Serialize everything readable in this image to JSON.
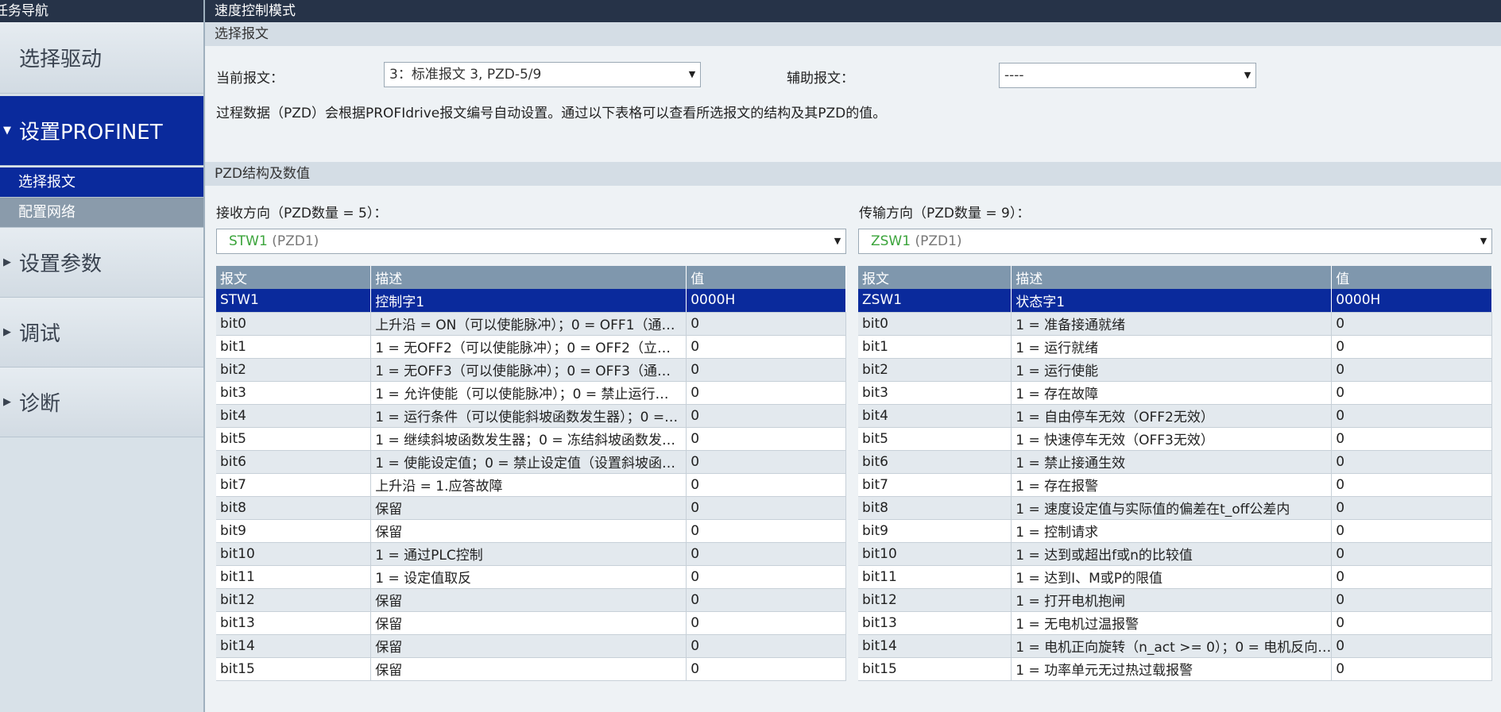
{
  "sidebar": {
    "header": "任务导航",
    "items": [
      {
        "label": "选择驱动"
      },
      {
        "label": "设置PROFINET"
      },
      {
        "label": "选择报文"
      },
      {
        "label": "配置网络"
      },
      {
        "label": "设置参数"
      },
      {
        "label": "调试"
      },
      {
        "label": "诊断"
      }
    ]
  },
  "main": {
    "header": "速度控制模式",
    "select_section": "选择报文",
    "current_label": "当前报文：",
    "current_value": "3：标准报文 3, PZD-5/9",
    "aux_label": "辅助报文：",
    "aux_value": "----",
    "info": "过程数据（PZD）会根据PROFIdrive报文编号自动设置。通过以下表格可以查看所选报文的结构及其PZD的值。",
    "pzd_section": "PZD结构及数值",
    "recv_label": "接收方向（PZD数量 = 5）：",
    "send_label": "传输方向（PZD数量 = 9）：",
    "recv_select_name": "STW1",
    "recv_select_pzd": "(PZD1)",
    "send_select_name": "ZSW1",
    "send_select_pzd": "(PZD1)"
  },
  "table_headers": [
    "报文",
    "描述",
    "值"
  ],
  "recv_rows": [
    [
      "STW1",
      "控制字1",
      "0000H"
    ],
    [
      "bit0",
      "上升沿 = ON（可以使能脉冲）；0 = OFF1（通…",
      "0"
    ],
    [
      "bit1",
      "1 = 无OFF2（可以使能脉冲）；0 = OFF2（立…",
      "0"
    ],
    [
      "bit2",
      "1 = 无OFF3（可以使能脉冲）；0 = OFF3（通…",
      "0"
    ],
    [
      "bit3",
      "1 = 允许使能（可以使能脉冲）；0 = 禁止运行…",
      "0"
    ],
    [
      "bit4",
      "1 = 运行条件（可以使能斜坡函数发生器）；0 =…",
      "0"
    ],
    [
      "bit5",
      "1 = 继续斜坡函数发生器；0 = 冻结斜坡函数发…",
      "0"
    ],
    [
      "bit6",
      "1 = 使能设定值；0 = 禁止设定值（设置斜坡函…",
      "0"
    ],
    [
      "bit7",
      "上升沿 = 1.应答故障",
      "0"
    ],
    [
      "bit8",
      "保留",
      "0"
    ],
    [
      "bit9",
      "保留",
      "0"
    ],
    [
      "bit10",
      "1 = 通过PLC控制",
      "0"
    ],
    [
      "bit11",
      "1 = 设定值取反",
      "0"
    ],
    [
      "bit12",
      "保留",
      "0"
    ],
    [
      "bit13",
      "保留",
      "0"
    ],
    [
      "bit14",
      "保留",
      "0"
    ],
    [
      "bit15",
      "保留",
      "0"
    ]
  ],
  "send_rows": [
    [
      "ZSW1",
      "状态字1",
      "0000H"
    ],
    [
      "bit0",
      "1 = 准备接通就绪",
      "0"
    ],
    [
      "bit1",
      "1 = 运行就绪",
      "0"
    ],
    [
      "bit2",
      "1 = 运行使能",
      "0"
    ],
    [
      "bit3",
      "1 = 存在故障",
      "0"
    ],
    [
      "bit4",
      "1 = 自由停车无效（OFF2无效）",
      "0"
    ],
    [
      "bit5",
      "1 = 快速停车无效（OFF3无效）",
      "0"
    ],
    [
      "bit6",
      "1 = 禁止接通生效",
      "0"
    ],
    [
      "bit7",
      "1 = 存在报警",
      "0"
    ],
    [
      "bit8",
      "1 = 速度设定值与实际值的偏差在t_off公差内",
      "0"
    ],
    [
      "bit9",
      "1 = 控制请求",
      "0"
    ],
    [
      "bit10",
      "1 = 达到或超出f或n的比较值",
      "0"
    ],
    [
      "bit11",
      "1 = 达到I、M或P的限值",
      "0"
    ],
    [
      "bit12",
      "1 = 打开电机抱闸",
      "0"
    ],
    [
      "bit13",
      "1 = 无电机过温报警",
      "0"
    ],
    [
      "bit14",
      "1 = 电机正向旋转（n_act >= 0）；0 = 电机反向…",
      "0"
    ],
    [
      "bit15",
      "1 = 功率单元无过热过载报警",
      "0"
    ]
  ]
}
